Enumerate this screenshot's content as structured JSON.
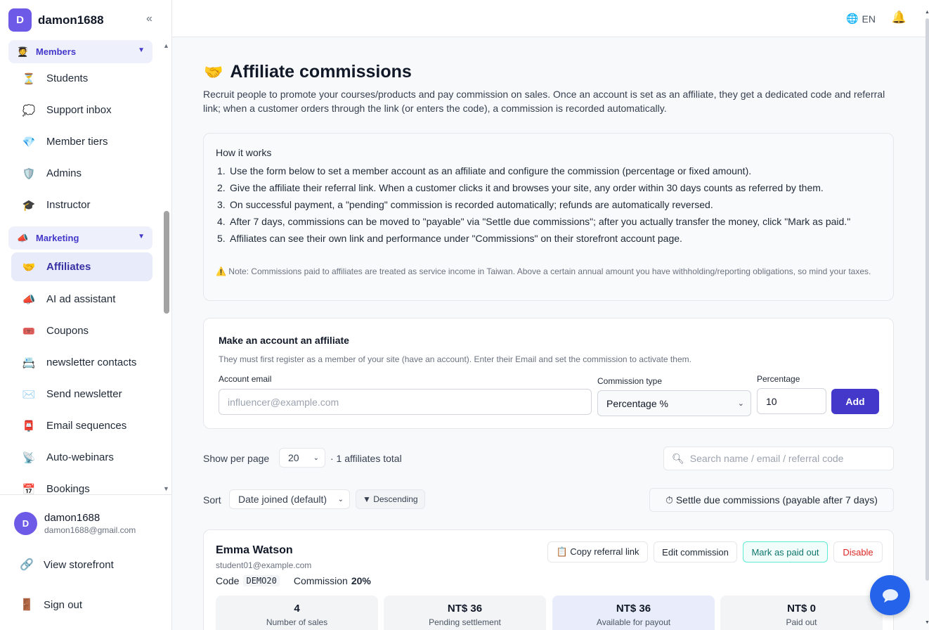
{
  "app": {
    "account": "damon1688",
    "avatar_letter": "D",
    "collapse_icon": "«"
  },
  "sidebar": {
    "groups": [
      {
        "label": "Members",
        "icon": "graduation-figure-icon"
      },
      {
        "label": "Marketing",
        "icon": "megaphone-icon"
      }
    ],
    "items": [
      {
        "label": "Students",
        "icon": "hourglass-icon"
      },
      {
        "label": "Support inbox",
        "icon": "speech-bubble-icon"
      },
      {
        "label": "Member tiers",
        "icon": "diamond-icon"
      },
      {
        "label": "Admins",
        "icon": "shield-icon"
      },
      {
        "label": "Instructor",
        "icon": "graduation-cap-icon"
      },
      {
        "label": "Affiliates",
        "icon": "handshake-icon",
        "active": true
      },
      {
        "label": "AI ad assistant",
        "icon": "megaphone-icon"
      },
      {
        "label": "Coupons",
        "icon": "ticket-icon"
      },
      {
        "label": "newsletter contacts",
        "icon": "contact-card-icon"
      },
      {
        "label": "Send newsletter",
        "icon": "envelope-icon"
      },
      {
        "label": "Email sequences",
        "icon": "mailbox-icon"
      },
      {
        "label": "Auto-webinars",
        "icon": "satellite-icon"
      },
      {
        "label": "Bookings",
        "icon": "calendar-icon"
      }
    ],
    "footer": {
      "user_name": "damon1688",
      "user_email": "damon1688@gmail.com",
      "view_storefront": "View storefront",
      "sign_out": "Sign out"
    }
  },
  "topbar": {
    "language": "EN"
  },
  "page": {
    "title": "Affiliate commissions",
    "description": "Recruit people to promote your courses/products and pay commission on sales. Once an account is set as an affiliate, they get a dedicated code and referral link; when a customer orders through the link (or enters the code), a commission is recorded automatically.",
    "how_title": "How it works",
    "steps": [
      "Use the form below to set a member account as an affiliate and configure the commission (percentage or fixed amount).",
      "Give the affiliate their referral link. When a customer clicks it and browses your site, any order within 30 days counts as referred by them.",
      "On successful payment, a \"pending\" commission is recorded automatically; refunds are automatically reversed.",
      "After 7 days, commissions can be moved to \"payable\" via \"Settle due commissions\"; after you actually transfer the money, click \"Mark as paid.\"",
      "Affiliates can see their own link and performance under \"Commissions\" on their storefront account page."
    ],
    "note": "⚠️ Note: Commissions paid to affiliates are treated as service income in Taiwan. Above a certain annual amount you have withholding/reporting obligations, so mind your taxes."
  },
  "form": {
    "title": "Make an account an affiliate",
    "subtitle": "They must first register as a member of your site (have an account). Enter their Email and set the commission to activate them.",
    "email_label": "Account email",
    "email_placeholder": "influencer@example.com",
    "type_label": "Commission type",
    "type_value": "Percentage %",
    "value_label": "Percentage",
    "value": "10",
    "add_label": "Add"
  },
  "list": {
    "per_page_label": "Show per page",
    "per_page": "20",
    "total_text": "· 1 affiliates total",
    "search_placeholder": "Search name / email / referral code",
    "sort_label": "Sort",
    "sort_value": "Date joined (default)",
    "direction": "▼ Descending",
    "settle_label": "⏱ Settle due commissions (payable after 7 days)"
  },
  "affiliate": {
    "name": "Emma Watson",
    "email": "student01@example.com",
    "code_label": "Code",
    "code": "DEMO20",
    "commission_label": "Commission",
    "commission": "20%",
    "buttons": {
      "copy": "📋 Copy referral link",
      "edit": "Edit commission",
      "paid": "Mark as paid out",
      "disable": "Disable"
    },
    "stats": [
      {
        "value": "4",
        "label": "Number of sales"
      },
      {
        "value": "NT$ 36",
        "label": "Pending settlement"
      },
      {
        "value": "NT$ 36",
        "label": "Available for payout"
      },
      {
        "value": "NT$ 0",
        "label": "Paid out"
      }
    ]
  },
  "colors": {
    "accent": "#4338ca",
    "brand": "#6d5ae6",
    "chat": "#2563eb"
  }
}
